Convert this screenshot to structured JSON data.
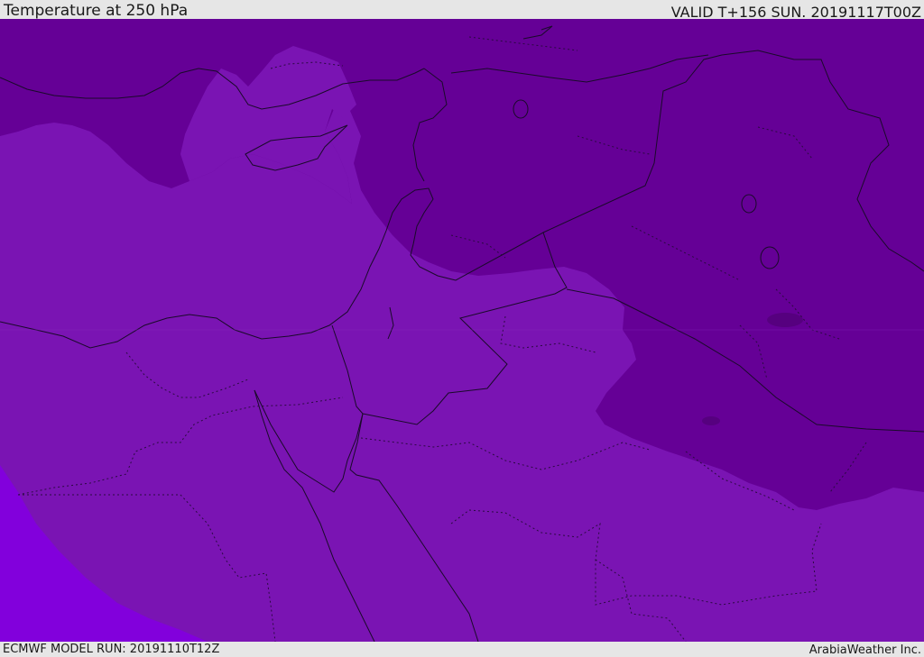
{
  "header": {
    "title": "Temperature at 250 hPa",
    "valid": "VALID T+156 SUN. 20191117T00Z"
  },
  "footer": {
    "model_run": "ECMWF MODEL RUN: 20191110T12Z",
    "credit": "ArabiaWeather Inc."
  },
  "map": {
    "colors": {
      "cold_band": "#650096",
      "mid_band": "#7a14b3",
      "warm_band": "#8200dc",
      "border": "#1a0a2a",
      "internal_border": "#2a0a40"
    }
  }
}
